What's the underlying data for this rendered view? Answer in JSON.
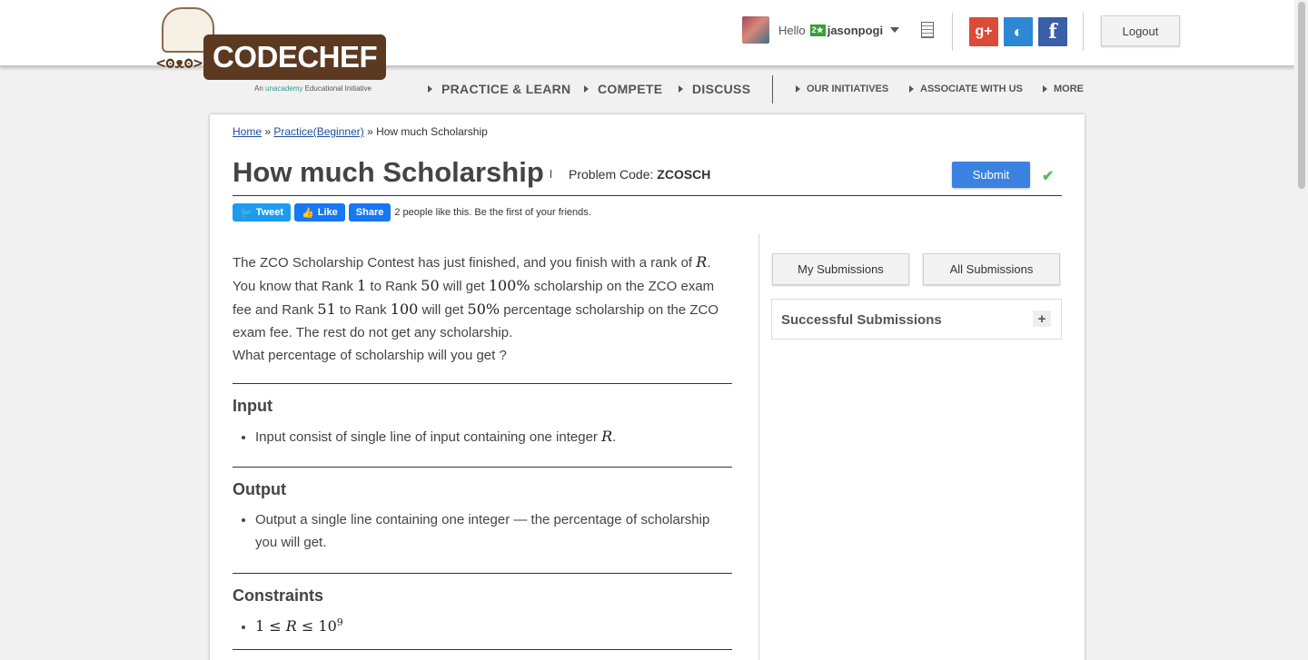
{
  "header": {
    "logo_text": "CODECHEF",
    "logo_face": "<ʘᴥʘ>",
    "tagline_prefix": "An ",
    "tagline_brand": "unacademy",
    "tagline_suffix": " Educational Initiative",
    "hello": "Hello",
    "stars": "2★",
    "username": "jasonpogi",
    "logout": "Logout",
    "social": {
      "google": "g+",
      "github": "◐",
      "facebook": "f"
    }
  },
  "nav": {
    "practice": "PRACTICE & LEARN",
    "compete": "COMPETE",
    "discuss": "DISCUSS",
    "initiatives": "OUR INITIATIVES",
    "associate": "ASSOCIATE WITH US",
    "more": "MORE"
  },
  "breadcrumb": {
    "home": "Home",
    "sep1": " » ",
    "practice": "Practice(Beginner)",
    "sep2": " » ",
    "current": "How much Scholarship"
  },
  "problem": {
    "title": "How much Scholarship",
    "code_label": "Problem Code: ",
    "code": "ZCOSCH",
    "submit": "Submit",
    "check": "✔"
  },
  "share": {
    "tweet": "Tweet",
    "like": "Like",
    "share": "Share",
    "likes_text": "2 people like this. Be the first of your friends."
  },
  "statement": {
    "p1a": "The ZCO Scholarship Contest has just finished, and you finish with a rank of ",
    "R": "R",
    "p1b": ". You know that Rank ",
    "n1": "1",
    "p1c": " to Rank ",
    "n50": "50",
    "p1d": " will get ",
    "n100p": "100%",
    "p1e": " scholarship on the ZCO exam fee and Rank ",
    "n51": "51",
    "p1f": " to Rank ",
    "n100": "100",
    "p1g": " will get ",
    "n50p": "50%",
    "p1h": " percentage scholarship on the ZCO exam fee. The rest do not get any scholarship.",
    "p2": "What percentage of scholarship will you get ?"
  },
  "input": {
    "title": "Input",
    "item_a": "Input consist of single line of input containing one integer ",
    "item_R": "R",
    "item_b": "."
  },
  "output": {
    "title": "Output",
    "item": "Output a single line containing one integer — the percentage of scholarship you will get."
  },
  "constraints": {
    "title": "Constraints",
    "c1": "1",
    "le1": " ≤ ",
    "R": "R",
    "le2": " ≤ ",
    "base": "10",
    "exp": "9"
  },
  "sidebar": {
    "my_submissions": "My Submissions",
    "all_submissions": "All Submissions",
    "successful": "Successful Submissions",
    "plus": "+"
  }
}
